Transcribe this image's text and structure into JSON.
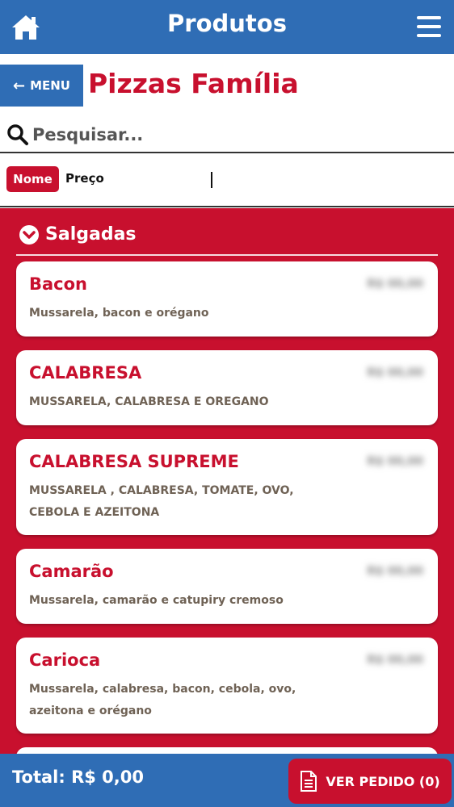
{
  "header": {
    "title": "Produtos",
    "home_icon": "home-icon",
    "menu_icon": "hamburger-menu-icon"
  },
  "nav": {
    "back_label": "MENU",
    "back_icon": "arrow-left-icon",
    "category_title": "Pizzas Família"
  },
  "search": {
    "placeholder": "Pesquisar...",
    "icon": "search-icon"
  },
  "sort": {
    "nome_label": "Nome",
    "preco_label": "Preço",
    "active": "Nome"
  },
  "section": {
    "title": "Salgadas",
    "icon": "chevron-down-circle-icon"
  },
  "products": [
    {
      "name": "Bacon",
      "description": "Mussarela, bacon e orégano",
      "price": "R$ 00,00"
    },
    {
      "name": "CALABRESA",
      "description": "MUSSARELA, CALABRESA E OREGANO",
      "price": "R$ 00,00"
    },
    {
      "name": "CALABRESA SUPREME",
      "description": "MUSSARELA , CALABRESA, TOMATE, OVO, CEBOLA E AZEITONA",
      "price": "R$ 00,00"
    },
    {
      "name": "Camarão",
      "description": "Mussarela, camarão e catupiry cremoso",
      "price": "R$ 00,00"
    },
    {
      "name": "Carioca",
      "description": "Mussarela, calabresa, bacon, cebola, ovo, azeitona e orégano",
      "price": "R$ 00,00"
    }
  ],
  "footer": {
    "total_label": "Total: R$ 0,00",
    "order_button_label": "VER PEDIDO (0)",
    "order_icon": "document-icon"
  },
  "colors": {
    "brand_blue": "#2f6db5",
    "brand_red": "#c8102e"
  }
}
